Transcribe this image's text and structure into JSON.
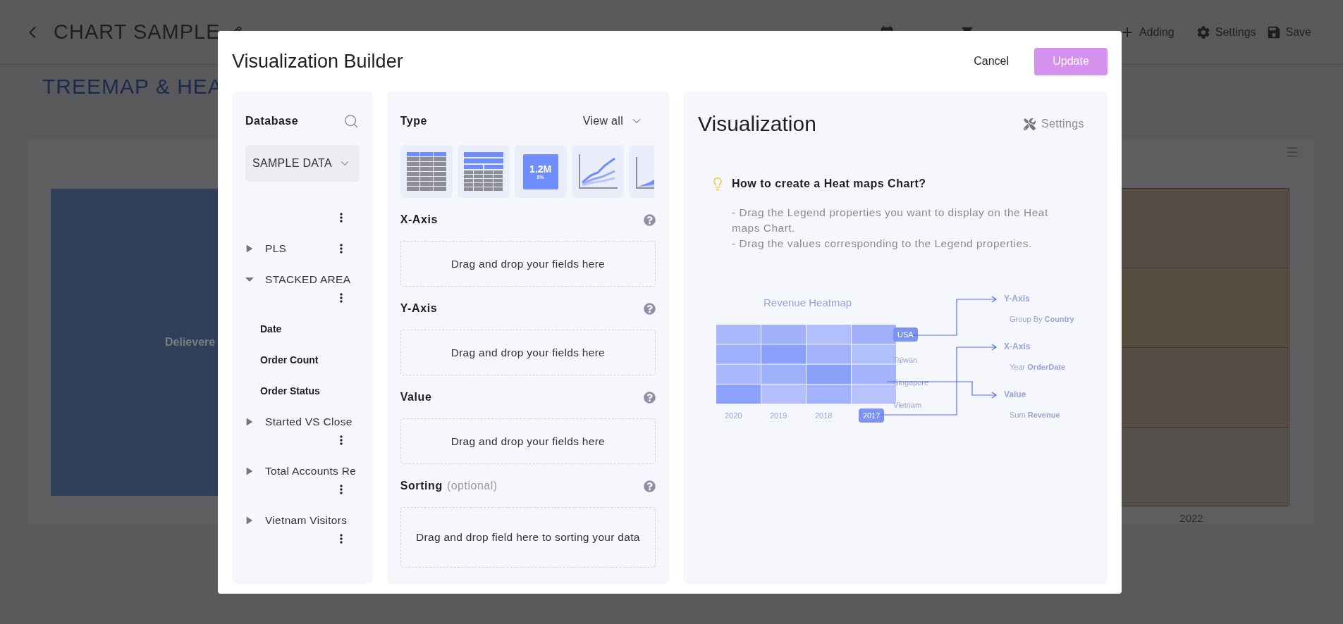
{
  "page": {
    "title": "CHART SAMPLE",
    "toolbar": [
      {
        "kind": "calendar"
      },
      {
        "kind": "filter"
      },
      {
        "kind": "add",
        "label": "Adding"
      },
      {
        "kind": "settings",
        "label": "Settings"
      },
      {
        "kind": "save",
        "label": "Save"
      }
    ],
    "section_title": "TREEMAP & HEA",
    "treemap_label": "Delievere",
    "x_label": "2022"
  },
  "modal": {
    "title": "Visualization Builder",
    "cancel": "Cancel",
    "update": {
      "label": "Update",
      "disabled": true
    },
    "database_panel": {
      "title": "Database",
      "source": "SAMPLE DATA",
      "tree": [
        {
          "kind": "menu-only"
        },
        {
          "kind": "folder",
          "label": "PLS",
          "expanded": false
        },
        {
          "kind": "folder",
          "label": "STACKED AREA",
          "expanded": true,
          "children": [
            {
              "label": "Date"
            },
            {
              "label": "Order Count"
            },
            {
              "label": "Order Status"
            }
          ]
        },
        {
          "kind": "folder",
          "label": "Started VS Close",
          "expanded": false
        },
        {
          "kind": "folder",
          "label": "Total Accounts Re",
          "expanded": false
        },
        {
          "kind": "folder",
          "label": "Vietnam Visitors",
          "expanded": false
        }
      ]
    },
    "fields_panel": {
      "type_label": "Type",
      "view_all": "View all",
      "chart_types": [
        {
          "kind": "table"
        },
        {
          "kind": "pivot"
        },
        {
          "kind": "kpi",
          "value": "1.2M",
          "delta": "5%"
        },
        {
          "kind": "line"
        },
        {
          "kind": "area"
        }
      ],
      "wells": [
        {
          "label": "X-Axis",
          "prompt": "Drag and drop your fields here"
        },
        {
          "label": "Y-Axis",
          "prompt": "Drag and drop your fields here"
        },
        {
          "label": "Value",
          "prompt": "Drag and drop your fields here"
        },
        {
          "label": "Sorting",
          "note": "(optional)",
          "prompt": "Drag and drop field here to sorting your data"
        }
      ]
    },
    "visualization_panel": {
      "title": "Visualization",
      "settings": "Settings",
      "help": {
        "title": "How to create a Heat maps Chart?",
        "lines": [
          "- Drag the Legend properties you want to display on the Heat maps Chart.",
          "- Drag the values corresponding to the Legend properties."
        ]
      },
      "illustration": {
        "title": "Revenue Heatmap",
        "rows": [
          {
            "label": "USA",
            "selected": true
          },
          {
            "label": "Taiwan",
            "selected": false
          },
          {
            "label": "Singapore",
            "selected": false
          },
          {
            "label": "Vietnam",
            "selected": false
          }
        ],
        "columns": [
          {
            "label": "2020",
            "selected": false
          },
          {
            "label": "2019",
            "selected": false
          },
          {
            "label": "2018",
            "selected": false
          },
          {
            "label": "2017",
            "selected": true
          }
        ],
        "mappings": [
          {
            "label": "Y-Axis",
            "detail": "Group By **Country**"
          },
          {
            "label": "X-Axis",
            "detail": "Year **OrderDate**"
          },
          {
            "label": "Value",
            "detail": "Sum **Revenue**"
          }
        ]
      }
    }
  }
}
